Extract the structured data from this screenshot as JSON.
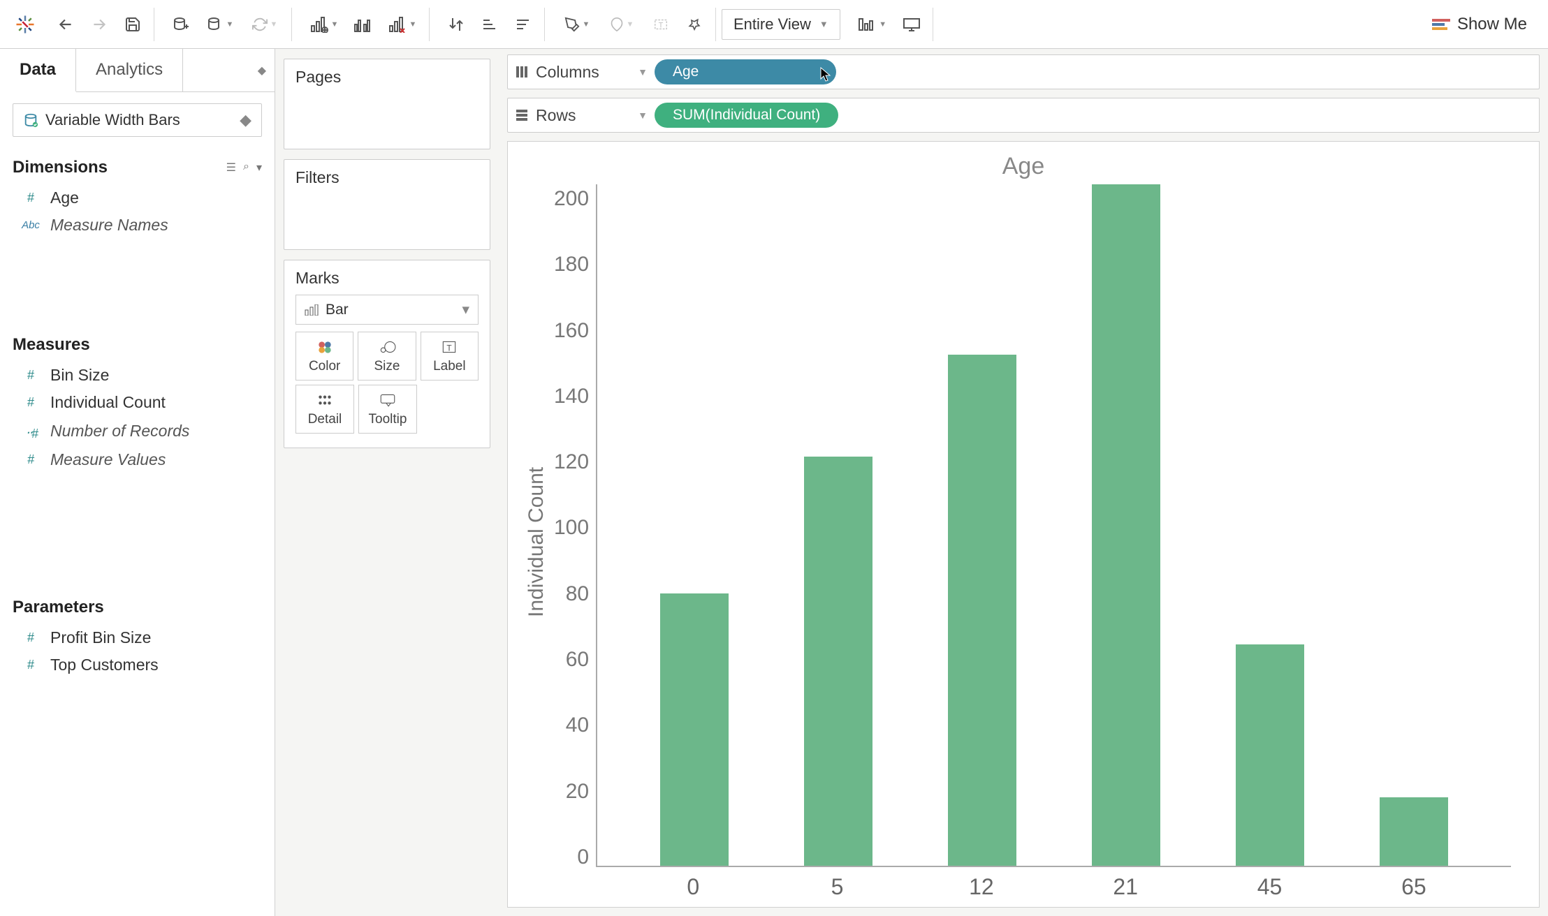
{
  "toolbar": {
    "view_mode": "Entire View",
    "showme_label": "Show Me"
  },
  "tabs": {
    "data": "Data",
    "analytics": "Analytics"
  },
  "data_source": {
    "name": "Variable Width Bars"
  },
  "sections": {
    "dimensions": {
      "title": "Dimensions",
      "fields": [
        {
          "label": "Age",
          "type": "#"
        },
        {
          "label": "Measure Names",
          "type": "Abc",
          "italic": true
        }
      ]
    },
    "measures": {
      "title": "Measures",
      "fields": [
        {
          "label": "Bin Size",
          "type": "#"
        },
        {
          "label": "Individual Count",
          "type": "#"
        },
        {
          "label": "Number of Records",
          "type": "=#",
          "italic": true
        },
        {
          "label": "Measure Values",
          "type": "#",
          "italic": true
        }
      ]
    },
    "parameters": {
      "title": "Parameters",
      "fields": [
        {
          "label": "Profit Bin Size",
          "type": "#"
        },
        {
          "label": "Top Customers",
          "type": "#"
        }
      ]
    }
  },
  "shelves": {
    "pages": "Pages",
    "filters": "Filters",
    "marks": {
      "title": "Marks",
      "type": "Bar",
      "buttons": {
        "color": "Color",
        "size": "Size",
        "label": "Label",
        "detail": "Detail",
        "tooltip": "Tooltip"
      }
    }
  },
  "colrow": {
    "columns_label": "Columns",
    "rows_label": "Rows",
    "columns_pill": "Age",
    "rows_pill": "SUM(Individual Count)"
  },
  "chart_data": {
    "type": "bar",
    "title": "Age",
    "ylabel": "Individual Count",
    "xlabel": "",
    "categories": [
      "0",
      "5",
      "12",
      "21",
      "45",
      "65"
    ],
    "values": [
      80,
      120,
      150,
      200,
      65,
      20
    ],
    "y_ticks": [
      "200",
      "180",
      "160",
      "140",
      "120",
      "100",
      "80",
      "60",
      "40",
      "20",
      "0"
    ],
    "ylim": [
      0,
      200
    ],
    "bar_color": "#6cb78a"
  }
}
